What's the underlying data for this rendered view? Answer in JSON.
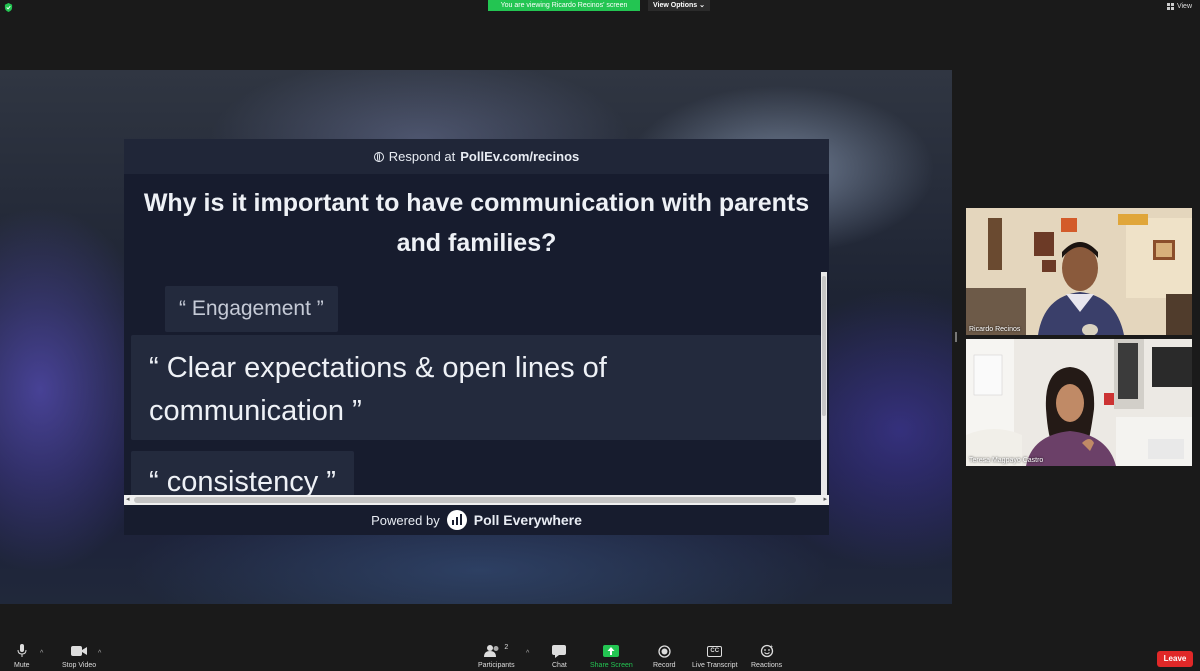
{
  "top": {
    "banner": "You are viewing Ricardo Recinos' screen",
    "view_options": "View Options",
    "view": "View"
  },
  "poll": {
    "respond_prefix": "Respond at",
    "respond_url": "PollEv.com/recinos",
    "question_line1": "Why is it important to have communication with parents",
    "question_line2": "and families?",
    "responses": [
      "“ Engagement ”",
      "“ Clear expectations & open lines of communication ”",
      "“ consistency ”"
    ],
    "powered_by": "Powered by",
    "brand": "Poll Everywhere"
  },
  "participants": [
    {
      "name": "Ricardo Recinos"
    },
    {
      "name": "Teresa Magpayo Castro"
    }
  ],
  "toolbar": {
    "mute": "Mute",
    "stop_video": "Stop Video",
    "participants": "Participants",
    "participants_count": "2",
    "chat": "Chat",
    "share_screen": "Share Screen",
    "record": "Record",
    "live_transcript": "Live Transcript",
    "cc": "CC",
    "reactions": "Reactions",
    "leave": "Leave"
  },
  "colors": {
    "banner_green": "#23c552",
    "leave_red": "#e02828",
    "share_green": "#23c552"
  }
}
